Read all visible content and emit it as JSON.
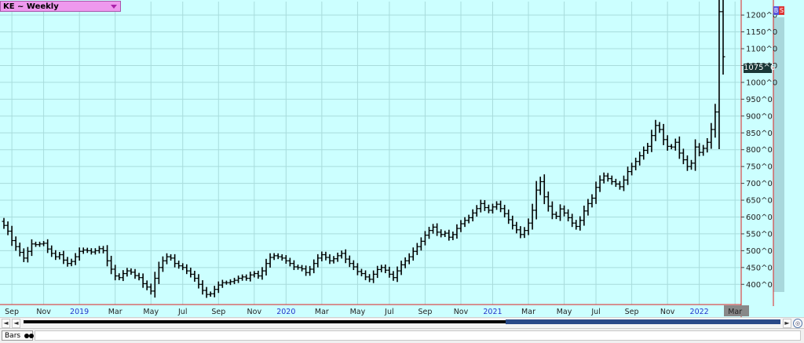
{
  "symbol": {
    "label": "KE ~ Weekly"
  },
  "price_marker": "1075^6",
  "bs_buttons": {
    "buy": "B",
    "sell": "S"
  },
  "bottom_tab": {
    "label": "Bars",
    "icon": "binoculars-icon"
  },
  "colors": {
    "background": "#ccffff",
    "bars": "#000000",
    "grid": "#a8dcdc",
    "price_axis_line": "#dd2222",
    "symbol_box": "#ee99ee"
  },
  "scrollbar": {
    "left_icon": "◄",
    "right_icon": "►"
  },
  "chart_data": {
    "type": "ohlc",
    "title": "KE ~ Weekly",
    "y_axis": {
      "position": "right",
      "ylim": [
        340,
        1240
      ],
      "tick_labels": [
        "1200^0",
        "1150^0",
        "1100^0",
        "1050^0",
        "1000^0",
        "950^0",
        "900^0",
        "850^0",
        "800^0",
        "750^0",
        "700^0",
        "650^0",
        "600^0",
        "550^0",
        "500^0",
        "450^0",
        "400^0"
      ],
      "tick_values": [
        1200,
        1150,
        1100,
        1050,
        1000,
        950,
        900,
        850,
        800,
        750,
        700,
        650,
        600,
        550,
        500,
        450,
        400
      ]
    },
    "x_axis": {
      "labels": [
        "Sep",
        "Nov",
        "2019",
        "Mar",
        "May",
        "Jul",
        "Sep",
        "Nov",
        "2020",
        "Mar",
        "May",
        "Jul",
        "Sep",
        "Nov",
        "2021",
        "Mar",
        "May",
        "Jul",
        "Sep",
        "Nov",
        "2022",
        "Mar"
      ],
      "label_weeks": [
        2,
        10,
        19,
        28,
        37,
        45,
        54,
        63,
        71,
        80,
        89,
        97,
        106,
        115,
        123,
        132,
        141,
        149,
        158,
        167,
        175,
        184
      ]
    },
    "grid": true,
    "closes": [
      575,
      558,
      530,
      512,
      495,
      478,
      498,
      520,
      518,
      520,
      522,
      505,
      492,
      482,
      488,
      472,
      462,
      468,
      482,
      498,
      502,
      500,
      496,
      500,
      506,
      500,
      470,
      445,
      425,
      420,
      432,
      440,
      436,
      426,
      420,
      402,
      392,
      380,
      418,
      450,
      470,
      482,
      478,
      462,
      455,
      450,
      440,
      430,
      418,
      400,
      382,
      370,
      372,
      385,
      398,
      405,
      405,
      408,
      412,
      418,
      422,
      418,
      428,
      432,
      425,
      440,
      462,
      480,
      485,
      482,
      478,
      470,
      462,
      452,
      450,
      446,
      435,
      445,
      462,
      478,
      488,
      480,
      470,
      476,
      485,
      492,
      475,
      462,
      452,
      438,
      432,
      422,
      415,
      430,
      444,
      450,
      442,
      430,
      420,
      440,
      458,
      470,
      482,
      498,
      512,
      528,
      546,
      560,
      570,
      555,
      548,
      552,
      540,
      548,
      566,
      580,
      590,
      598,
      612,
      625,
      640,
      628,
      620,
      630,
      638,
      625,
      610,
      592,
      575,
      562,
      548,
      560,
      582,
      620,
      680,
      705,
      660,
      632,
      608,
      602,
      624,
      612,
      598,
      582,
      572,
      590,
      618,
      640,
      656,
      688,
      710,
      722,
      714,
      705,
      698,
      690,
      710,
      735,
      750,
      765,
      782,
      798,
      810,
      842,
      872,
      860,
      830,
      810,
      808,
      822,
      790,
      770,
      750,
      760,
      808,
      792,
      804,
      822,
      860,
      912,
      1210,
      1076
    ]
  }
}
